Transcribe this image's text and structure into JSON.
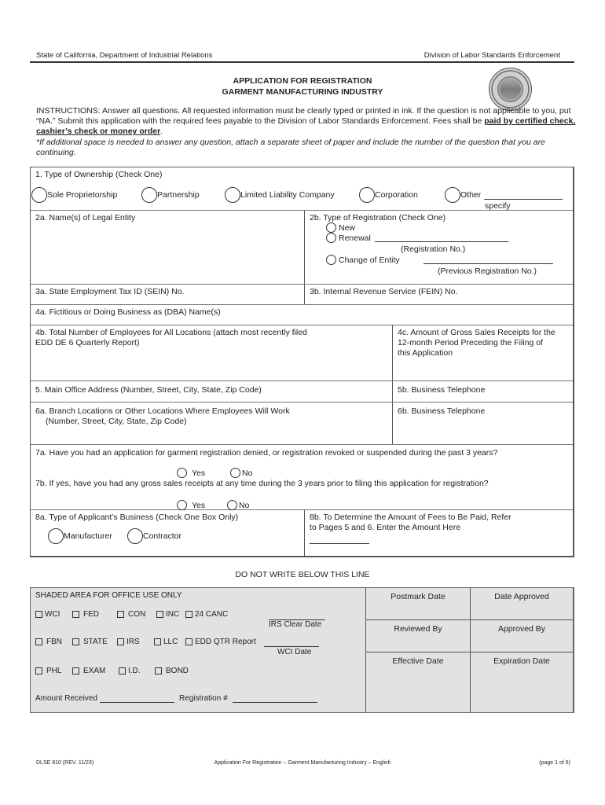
{
  "header": {
    "left": "State of California, Department of Industrial Relations",
    "right": "Division of Labor Standards Enforcement"
  },
  "title": {
    "line1": "APPLICATION FOR REGISTRATION",
    "line2": "GARMENT MANUFACTURING INDUSTRY"
  },
  "seal_icon": "california-state-seal",
  "instructions": {
    "text1": "INSTRUCTIONS: Answer all questions.  All requested information must be clearly typed or printed in ink.  If the question is not applicable to you, put “NA.”  Submit this application with the required fees payable to the Division of Labor Standards Enforcement.  Fees shall be ",
    "emphasis": "paid by certified check, cashier’s check or money order",
    "text2": ".",
    "note": "*If additional space is needed to answer any question, attach a separate sheet of paper and include the number of the question that you are continuing."
  },
  "q1": {
    "label": "1. Type of Ownership (Check One)",
    "options": [
      "Sole Proprietorship",
      "Partnership",
      "Limited Liability Company",
      "Corporation",
      "Other"
    ],
    "other_caption": "specify"
  },
  "q2a": {
    "label": "2a.  Name(s) of Legal Entity"
  },
  "q2b": {
    "label": "2b. Type of Registration (Check One)",
    "new": "New",
    "renewal": "Renewal",
    "renewal_caption": "(Registration No.)",
    "change": "Change of Entity",
    "change_caption": "(Previous Registration No.)"
  },
  "q3a": {
    "label": "3a. State Employment Tax ID (SEIN) No."
  },
  "q3b": {
    "label": "3b. Internal Revenue Service (FEIN) No."
  },
  "q4a": {
    "label": "4a. Fictitious or Doing Business as (DBA) Name(s)"
  },
  "q4b": {
    "line1": "4b. Total Number of Employees for All Locations (attach most recently filed",
    "line2": "EDD DE 6 Quarterly Report)"
  },
  "q4c": {
    "line1": "4c. Amount of Gross Sales Receipts for the",
    "line2": "12-month Period Preceding the Filing of",
    "line3": "this Application"
  },
  "q5": {
    "label": "5.  Main Office Address (Number, Street, City, State, Zip Code)"
  },
  "q5b": {
    "label": "5b. Business Telephone"
  },
  "q6a": {
    "line1": "6a. Branch Locations or Other Locations Where Employees Will Work",
    "line2": "(Number, Street, City, State, Zip Code)"
  },
  "q6b": {
    "label": "6b. Business Telephone"
  },
  "q7a": {
    "label": "7a. Have you had an application for garment registration denied, or registration revoked or suspended during the past 3 years?",
    "yes": "Yes",
    "no": "No"
  },
  "q7b": {
    "label": "7b. If yes, have you had any gross sales receipts at any time during the 3 years prior to filing this application for registration?",
    "yes": "Yes",
    "no": "No"
  },
  "q8a": {
    "label": "8a. Type of Applicant’s Business (Check One Box Only)",
    "options": [
      "Manufacturer",
      "Contractor"
    ]
  },
  "q8b": {
    "line1": "8b. To Determine the Amount of Fees to Be Paid, Refer",
    "line2": "to Pages 5 and 6.  Enter the Amount Here"
  },
  "divider_text": "DO NOT WRITE BELOW THIS LINE",
  "office": {
    "title": "SHADED AREA FOR OFFICE USE ONLY",
    "row1": [
      "WCI",
      "FED",
      "CON",
      "INC",
      "24 CANC"
    ],
    "row2": [
      "FBN",
      "STATE",
      "IRS",
      "LLC",
      "EDD QTR Report"
    ],
    "row3": [
      "PHL",
      "EXAM",
      "I.D.",
      "BOND"
    ],
    "irs_clear_date": "IRS Clear Date",
    "wci_date": "WCI Date",
    "amount_received": "Amount Received",
    "registration_no": "Registration #",
    "grid": [
      "Postmark Date",
      "Date Approved",
      "Reviewed By",
      "Approved By",
      "Effective Date",
      "Expiration Date"
    ]
  },
  "footer": {
    "left": "DLSE 810 (REV. 11/23)",
    "center": "Application For Registration – Garment Manufacturing Industry – English",
    "right": "(page 1 of 6)"
  }
}
